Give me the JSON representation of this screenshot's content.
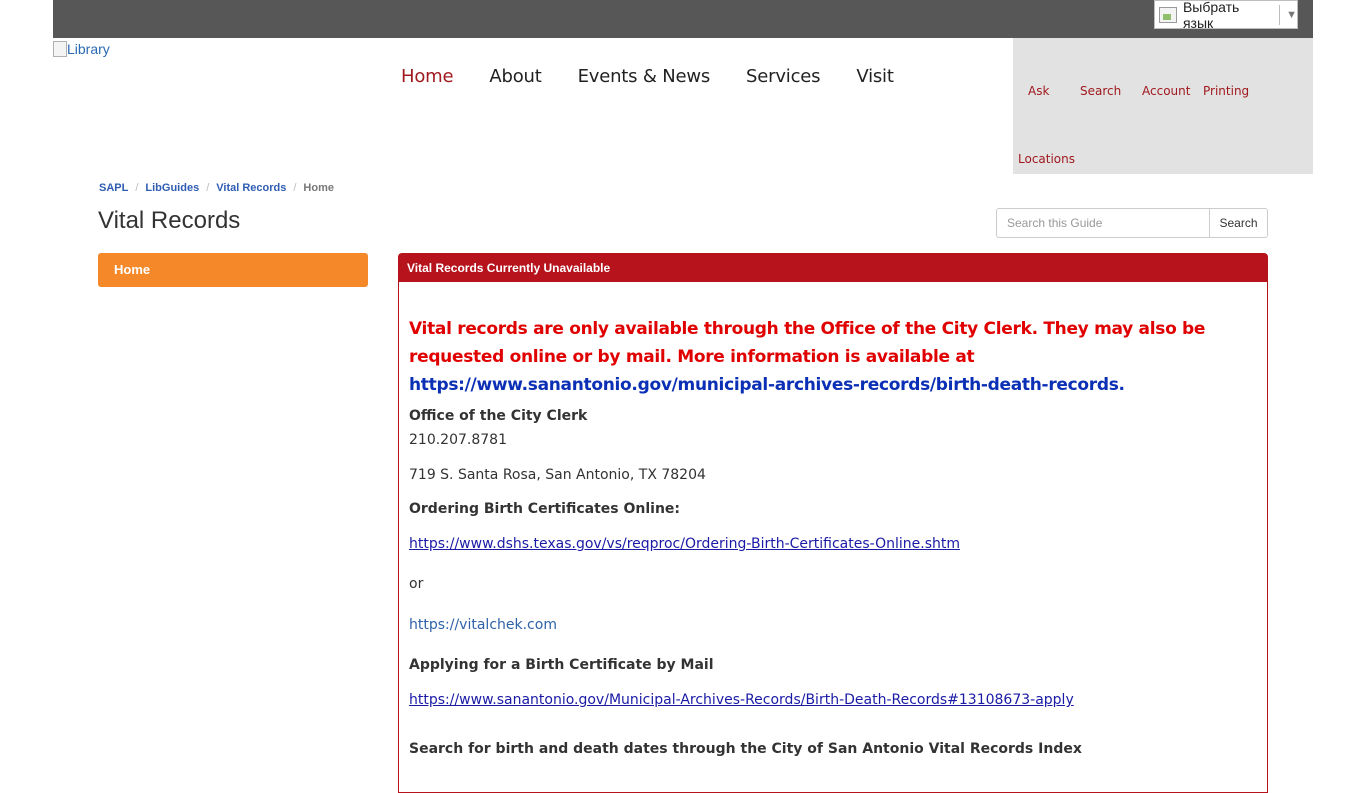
{
  "language": {
    "label": "Выбрать язык"
  },
  "logo": {
    "alt": "Library"
  },
  "nav": {
    "main": [
      "Home",
      "About",
      "Events & News",
      "Services",
      "Visit"
    ],
    "utility": {
      "ask": "Ask",
      "search": "Search",
      "account": "Account",
      "printing": "Printing",
      "locations": "Locations"
    }
  },
  "breadcrumb": [
    "SAPL",
    "LibGuides",
    "Vital Records",
    "Home"
  ],
  "page": {
    "title": "Vital Records"
  },
  "guide_search": {
    "placeholder": "Search this Guide",
    "button": "Search"
  },
  "sidebar": {
    "home": "Home"
  },
  "panel": {
    "heading": "Vital Records Currently Unavailable",
    "alert": "Vital records are only available through the Office of the City Clerk. They may also be requested online or by mail. More information is available at ",
    "alert_link": "https://www.sanantonio.gov/municipal-archives-records/birth-death-records.",
    "office_title": "Office of the City Clerk",
    "phone": "210.207.8781",
    "address": "719 S. Santa Rosa, San Antonio, TX 78204",
    "ordering_title": "Ordering Birth Certificates Online:",
    "ordering_link": "https://www.dshs.texas.gov/vs/reqproc/Ordering-Birth-Certificates-Online.shtm",
    "or_text": "or",
    "vitalchek_link": "https://vitalchek.com",
    "mail_title": "Applying for a Birth Certificate by Mail",
    "mail_link": "https://www.sanantonio.gov/Municipal-Archives-Records/Birth-Death-Records#13108673-apply",
    "index_title": "Search for birth and death dates through the City of San Antonio Vital Records Index"
  }
}
